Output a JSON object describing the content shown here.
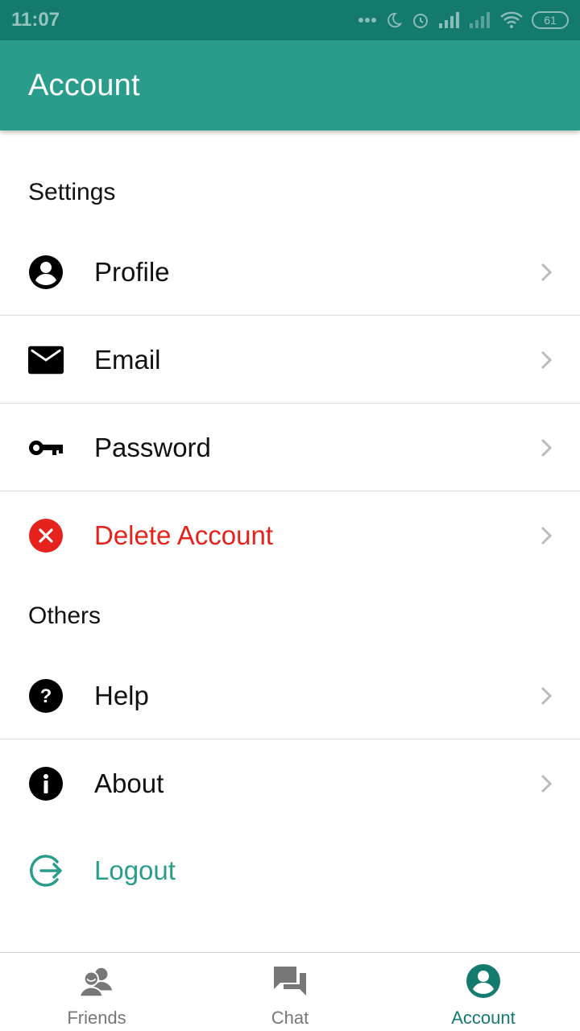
{
  "status_bar": {
    "time": "11:07",
    "battery": "61"
  },
  "app_bar": {
    "title": "Account",
    "background": "#2a9c8b"
  },
  "sections": {
    "settings": {
      "header": "Settings",
      "items": [
        {
          "label": "Profile",
          "icon": "account-circle-icon"
        },
        {
          "label": "Email",
          "icon": "mail-icon"
        },
        {
          "label": "Password",
          "icon": "key-icon"
        },
        {
          "label": "Delete Account",
          "icon": "cancel-icon",
          "color": "#e5221b"
        }
      ]
    },
    "others": {
      "header": "Others",
      "items": [
        {
          "label": "Help",
          "icon": "help-icon"
        },
        {
          "label": "About",
          "icon": "info-icon"
        },
        {
          "label": "Logout",
          "icon": "logout-icon",
          "color": "#2a9c8b"
        }
      ]
    }
  },
  "bottom_nav": {
    "items": [
      {
        "label": "Friends",
        "icon": "friends-icon",
        "active": false
      },
      {
        "label": "Chat",
        "icon": "chat-icon",
        "active": false
      },
      {
        "label": "Account",
        "icon": "account-circle-icon",
        "active": true
      }
    ],
    "active_color": "#147a6e",
    "inactive_color": "#777777"
  }
}
